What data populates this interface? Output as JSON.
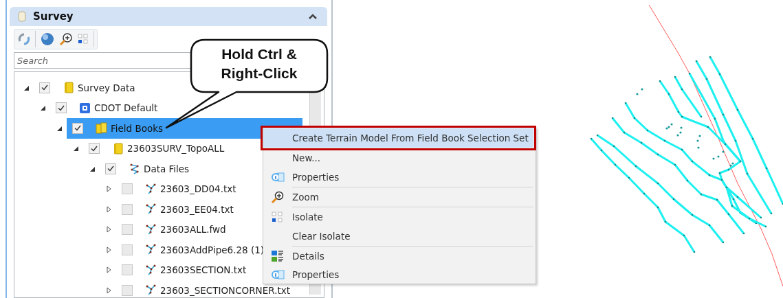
{
  "panel": {
    "title": "Survey",
    "collapsed": false
  },
  "search": {
    "placeholder": "Search"
  },
  "tree": [
    {
      "label": "Survey Data",
      "kind": "folder",
      "expanded": true,
      "checked": true,
      "selected": false,
      "children": [
        {
          "label": "CDOT Default",
          "kind": "database",
          "expanded": true,
          "checked": true,
          "selected": false,
          "children": [
            {
              "label": "Field Books",
              "kind": "books",
              "expanded": true,
              "checked": true,
              "selected": true,
              "children": [
                {
                  "label": "23603SURV_TopoALL",
                  "kind": "folder",
                  "expanded": true,
                  "checked": true,
                  "selected": false,
                  "children": [
                    {
                      "label": "Data Files",
                      "kind": "network",
                      "expanded": true,
                      "checked": true,
                      "selected": false,
                      "children": [
                        {
                          "label": "23603_DD04.txt",
                          "kind": "file",
                          "expanded": false,
                          "checked": false,
                          "selected": false
                        },
                        {
                          "label": "23603_EE04.txt",
                          "kind": "file",
                          "expanded": false,
                          "checked": false,
                          "selected": false
                        },
                        {
                          "label": "23603ALL.fwd",
                          "kind": "file",
                          "expanded": false,
                          "checked": false,
                          "selected": false
                        },
                        {
                          "label": "23603AddPipe6.28 (1)",
                          "kind": "file",
                          "expanded": false,
                          "checked": false,
                          "selected": false
                        },
                        {
                          "label": "23603SECTION.txt",
                          "kind": "file",
                          "expanded": false,
                          "checked": false,
                          "selected": false
                        },
                        {
                          "label": "23603_SECTIONCORNER.txt",
                          "kind": "file",
                          "expanded": false,
                          "checked": false,
                          "selected": false
                        }
                      ]
                    }
                  ]
                }
              ]
            }
          ]
        }
      ]
    }
  ],
  "callout": {
    "text": "Hold Ctrl & Right-Click"
  },
  "context_menu": [
    {
      "label": "Create Terrain Model From Field Book Selection Set",
      "kind": "plain",
      "highlighted": true,
      "separator_before": false
    },
    {
      "label": "New...",
      "kind": "plain",
      "highlighted": false,
      "separator_before": false
    },
    {
      "label": "Properties",
      "kind": "info",
      "highlighted": false,
      "separator_before": false
    },
    {
      "label": "Zoom",
      "kind": "zoom",
      "highlighted": false,
      "separator_before": true
    },
    {
      "label": "Isolate",
      "kind": "isolate",
      "highlighted": false,
      "separator_before": true
    },
    {
      "label": "Clear Isolate",
      "kind": "plain",
      "highlighted": false,
      "separator_before": false
    },
    {
      "label": "Details",
      "kind": "details",
      "highlighted": false,
      "separator_before": true
    },
    {
      "label": "Properties",
      "kind": "info",
      "highlighted": false,
      "separator_before": false
    }
  ]
}
